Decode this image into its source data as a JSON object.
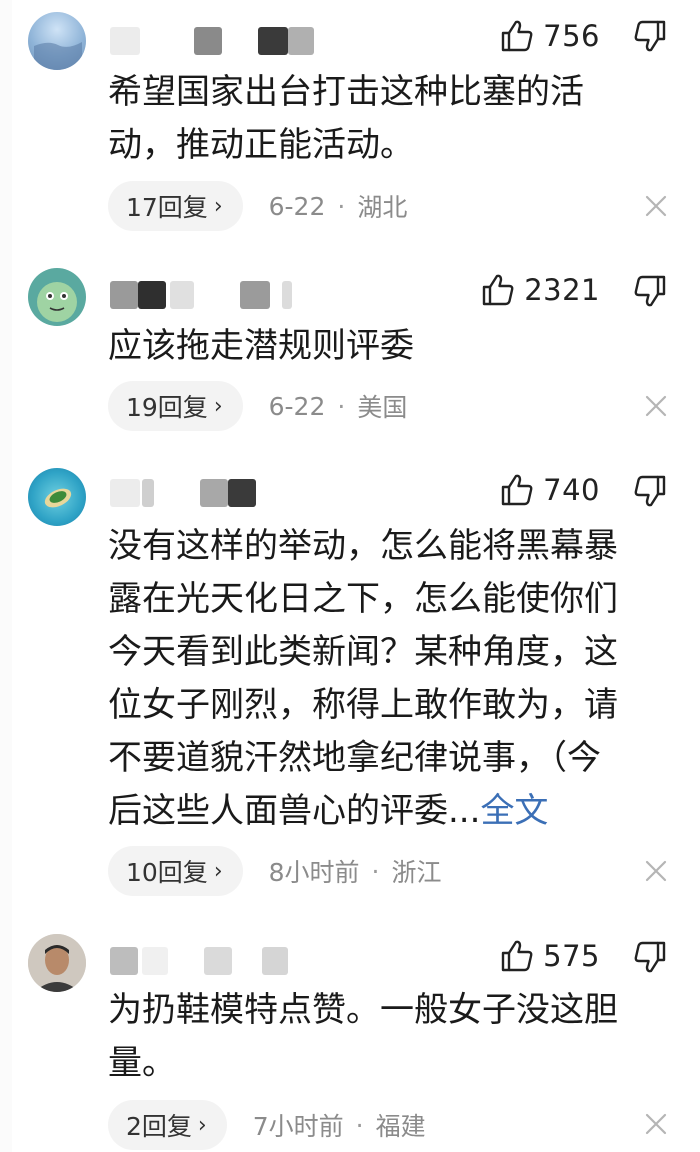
{
  "comments": [
    {
      "likes": "756",
      "text": "希望国家出台打击这种比塞的活动，推动正能活动。",
      "lines": [
        "希望国家出台打击这种比塞的活",
        "动，推动正能活动。"
      ],
      "replies": "17回复",
      "time": "6-22",
      "location": "湖北"
    },
    {
      "likes": "2321",
      "text": "应该拖走潜规则评委",
      "lines": [
        "应该拖走潜规则评委"
      ],
      "replies": "19回复",
      "time": "6-22",
      "location": "美国"
    },
    {
      "likes": "740",
      "lines": [
        "没有这样的举动，怎么能将黑幕暴",
        "露在光天化日之下，怎么能使你们",
        "今天看到此类新闻？某种角度，这",
        "位女子刚烈，称得上敢作敢为，请",
        "不要道貌汗然地拿纪律说事，（今",
        "后这些人面兽心的评委..."
      ],
      "full_label": "全文",
      "replies": "10回复",
      "time": "8小时前",
      "location": "浙江"
    },
    {
      "likes": "575",
      "lines": [
        "为扔鞋模特点赞。一般女子没这胆",
        "量。"
      ],
      "replies": "2回复",
      "time": "7小时前",
      "location": "福建"
    }
  ],
  "icons": {
    "like": "thumbs-up-icon",
    "dislike": "thumbs-down-icon",
    "close": "close-icon",
    "reply_arrow": "chevron-right-icon"
  },
  "colors": {
    "text": "#1a1a1a",
    "meta": "#8b8b8b",
    "link": "#3b6fb6",
    "pill": "#f3f3f3"
  }
}
